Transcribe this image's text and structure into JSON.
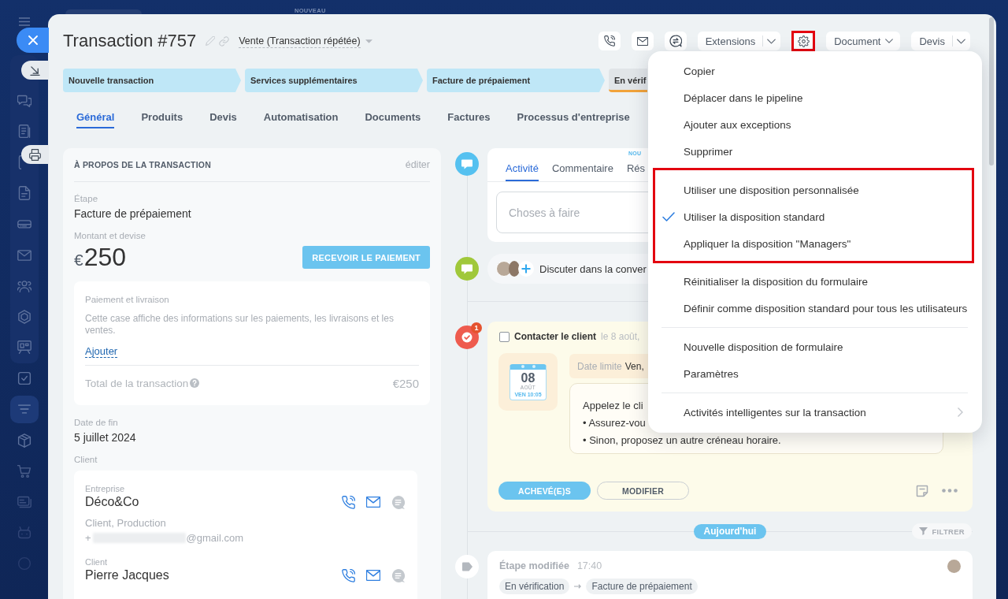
{
  "top_bar": {
    "badge": "NOUVEAU"
  },
  "sidebar": {
    "items": [
      {
        "selected": false
      },
      {
        "selected": false
      },
      {
        "selected": false
      },
      {
        "selected": false
      },
      {
        "selected": false
      },
      {
        "selected": false
      },
      {
        "selected": false
      },
      {
        "selected": false
      },
      {
        "selected": false
      },
      {
        "selected": false
      },
      {
        "selected": true
      },
      {
        "selected": false
      },
      {
        "selected": false
      },
      {
        "selected": false
      },
      {
        "selected": false
      },
      {
        "selected": false
      }
    ]
  },
  "header": {
    "title": "Transaction #757",
    "category": "Vente (Transaction répétée)",
    "extensions_button": "Extensions",
    "settings_highlighted": true,
    "document_button": "Document",
    "quote_button": "Devis"
  },
  "pipeline": [
    {
      "label": "Nouvelle transaction",
      "reached": true
    },
    {
      "label": "Services supplémentaires",
      "reached": true
    },
    {
      "label": "Facture de prépaiement",
      "reached": true
    },
    {
      "label": "En vérif",
      "reached": false
    }
  ],
  "tabs": [
    {
      "label": "Général",
      "selected": true
    },
    {
      "label": "Produits",
      "selected": false
    },
    {
      "label": "Devis",
      "selected": false
    },
    {
      "label": "Automatisation",
      "selected": false
    },
    {
      "label": "Documents",
      "selected": false
    },
    {
      "label": "Factures",
      "selected": false
    },
    {
      "label": "Processus d'entreprise",
      "selected": false
    }
  ],
  "deal_info": {
    "title": "À PROPOS DE LA TRANSACTION",
    "edit_link": "éditer",
    "stage": {
      "label": "Étape",
      "value": "Facture de prépaiement"
    },
    "amount": {
      "label": "Montant et devise",
      "currency": "€",
      "value": "250",
      "button": "RECEVOIR LE PAIEMENT"
    },
    "payment_box": {
      "title": "Paiement et livraison",
      "description": "Cette case affiche des informations sur les paiements, les livraisons et les ventes.",
      "add_link": "Ajouter",
      "total_label": "Total de la transaction",
      "total_value": "€250"
    },
    "close_date": {
      "label": "Date de fin",
      "value": "5 juillet 2024"
    },
    "client": {
      "label": "Client",
      "contacts": [
        {
          "role": "Entreprise",
          "name": "Déco&Co",
          "lines": [
            {
              "kind": "text",
              "text": "Client, Production"
            },
            {
              "kind": "redacted",
              "prefix": "+",
              "suffix": "@gmail.com"
            }
          ]
        },
        {
          "role": "Client",
          "name": "Pierre Jacques"
        }
      ]
    }
  },
  "activity": {
    "tabs": [
      {
        "label": "Activité",
        "selected": true
      },
      {
        "label": "Commentaire",
        "selected": false
      },
      {
        "label": "Rés",
        "selected": false,
        "badge": "NOU"
      }
    ],
    "placeholder": "Choses à faire"
  },
  "chat": {
    "label": "Discuter dans la conver"
  },
  "task": {
    "badge": "1",
    "checked": false,
    "title": "Contacter le client",
    "date": "le 8 août,",
    "calendar": {
      "day": "08",
      "month": "AOÛT",
      "time": "VEN 10:05"
    },
    "deadline": {
      "label": "Date limite",
      "value": "Ven,"
    },
    "note": [
      "Appelez le cli",
      "• Assurez-vou",
      "• Sinon, proposez un autre créneau horaire."
    ],
    "complete_button": "ACHEVÉ(E)S",
    "edit_button": "MODIFIER"
  },
  "timeline_divider": {
    "label": "Aujourd'hui",
    "filter_button": "FILTRER"
  },
  "history": {
    "title": "Étape modifiée",
    "time": "17:40",
    "from": "En vérification",
    "to": "Facture de prépaiement"
  },
  "menu": {
    "sections": [
      {
        "highlighted": false,
        "separated": false,
        "items": [
          {
            "label": "Copier"
          },
          {
            "label": "Déplacer dans le pipeline"
          },
          {
            "label": "Ajouter aux exceptions"
          },
          {
            "label": "Supprimer"
          }
        ]
      },
      {
        "highlighted": true,
        "separated": false,
        "items": [
          {
            "label": "Utiliser une disposition personnalisée",
            "checked": false
          },
          {
            "label": "Utiliser la disposition standard",
            "checked": true
          },
          {
            "label": "Appliquer la disposition \"Managers\"",
            "checked": false
          }
        ]
      },
      {
        "highlighted": false,
        "separated": false,
        "items": [
          {
            "label": "Réinitialiser la disposition du formulaire"
          },
          {
            "label": "Définir comme disposition standard pour tous les utilisateurs"
          }
        ]
      },
      {
        "highlighted": false,
        "separated": true,
        "items": [
          {
            "label": "Nouvelle disposition de formulaire"
          },
          {
            "label": "Paramètres"
          }
        ]
      },
      {
        "highlighted": false,
        "separated": true,
        "items": [
          {
            "label": "Activités intelligentes sur la transaction",
            "submenu": true
          }
        ]
      }
    ]
  }
}
